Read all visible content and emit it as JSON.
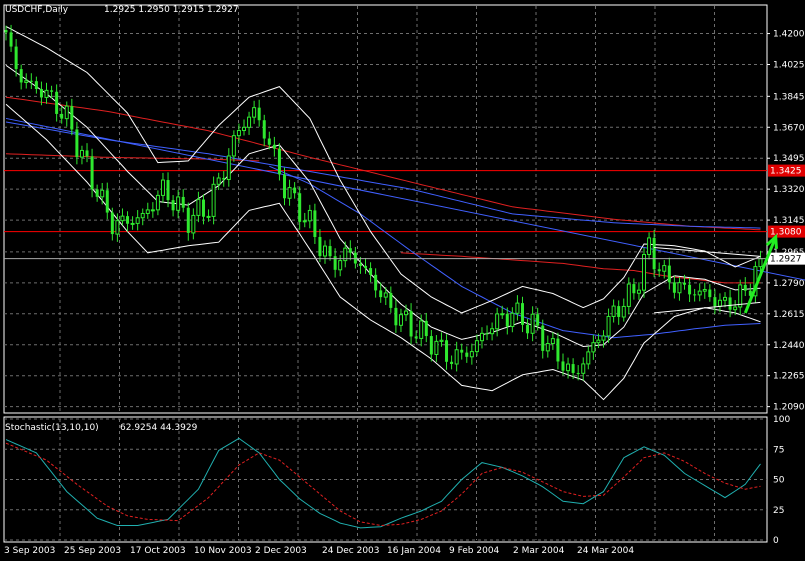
{
  "header": {
    "symbol_label": "USDCHF,Daily",
    "ohlc_text": "1.2925 1.2950 1.2915 1.2927"
  },
  "stochastic_header": {
    "label": "Stochastic(13,10,10)",
    "values_text": "62.9254 44.3929"
  },
  "colors": {
    "background": "#000000",
    "grid": "#6e6e6e",
    "candle": "#2fe82f",
    "bollinger": "#ffffff",
    "ma_red": "#e02020",
    "ma_blue": "#4060ff",
    "support_line": "#ff0000",
    "trend_line": "#4060ff",
    "arrow": "#22ee22",
    "stoch_main": "#20b0b0",
    "stoch_signal": "#e02020",
    "axis_text": "#ffffff",
    "label_red_bg": "#e00000"
  },
  "chart_data": [
    {
      "type": "candlestick",
      "title": "",
      "xlabel": "",
      "ylabel": "",
      "ylim": [
        1.2054,
        1.4288
      ],
      "y_ticks": [
        "1.4200",
        "1.4025",
        "1.3845",
        "1.3670",
        "1.3495",
        "1.3320",
        "1.3145",
        "1.2965",
        "1.2790",
        "1.2615",
        "1.2440",
        "1.2265",
        "1.2090"
      ],
      "x_tick_labels": [
        "3 Sep 2003",
        "25 Sep 2003",
        "17 Oct 2003",
        "10 Nov 2003",
        "2 Dec 2003",
        "24 Dec 2003",
        "16 Jan 2004",
        "9 Feb 2004",
        "2 Mar 2004",
        "24 Mar 2004"
      ],
      "grid": true,
      "last_price_label": "1.2927",
      "horizontal_levels": [
        {
          "value": 1.3425,
          "label": "1.3425"
        },
        {
          "value": 1.308,
          "label": "1.3080"
        }
      ],
      "bar_count": 150,
      "close_anchors": [
        [
          0,
          1.418
        ],
        [
          3,
          1.394
        ],
        [
          8,
          1.386
        ],
        [
          12,
          1.372
        ],
        [
          16,
          1.344
        ],
        [
          21,
          1.312
        ],
        [
          27,
          1.316
        ],
        [
          31,
          1.332
        ],
        [
          36,
          1.315
        ],
        [
          40,
          1.322
        ],
        [
          43,
          1.343
        ],
        [
          46,
          1.366
        ],
        [
          49,
          1.376
        ],
        [
          52,
          1.358
        ],
        [
          55,
          1.333
        ],
        [
          60,
          1.312
        ],
        [
          64,
          1.29
        ],
        [
          68,
          1.296
        ],
        [
          72,
          1.282
        ],
        [
          76,
          1.264
        ],
        [
          80,
          1.254
        ],
        [
          84,
          1.246
        ],
        [
          88,
          1.236
        ],
        [
          92,
          1.241
        ],
        [
          96,
          1.256
        ],
        [
          100,
          1.262
        ],
        [
          104,
          1.255
        ],
        [
          108,
          1.241
        ],
        [
          112,
          1.226
        ],
        [
          116,
          1.243
        ],
        [
          120,
          1.262
        ],
        [
          124,
          1.274
        ],
        [
          127,
          1.299
        ],
        [
          130,
          1.282
        ],
        [
          134,
          1.275
        ],
        [
          138,
          1.273
        ],
        [
          142,
          1.266
        ],
        [
          146,
          1.273
        ],
        [
          149,
          1.2927
        ]
      ],
      "bollinger_upper_anchors": [
        [
          0,
          1.424
        ],
        [
          8,
          1.412
        ],
        [
          16,
          1.398
        ],
        [
          24,
          1.375
        ],
        [
          30,
          1.347
        ],
        [
          36,
          1.348
        ],
        [
          42,
          1.368
        ],
        [
          48,
          1.384
        ],
        [
          54,
          1.39
        ],
        [
          60,
          1.372
        ],
        [
          66,
          1.337
        ],
        [
          72,
          1.308
        ],
        [
          78,
          1.284
        ],
        [
          84,
          1.271
        ],
        [
          90,
          1.262
        ],
        [
          96,
          1.269
        ],
        [
          102,
          1.277
        ],
        [
          108,
          1.273
        ],
        [
          114,
          1.265
        ],
        [
          118,
          1.27
        ],
        [
          122,
          1.282
        ],
        [
          126,
          1.301
        ],
        [
          132,
          1.3
        ],
        [
          138,
          1.297
        ],
        [
          144,
          1.288
        ],
        [
          149,
          1.294
        ]
      ],
      "bollinger_middle_anchors": [
        [
          0,
          1.402
        ],
        [
          8,
          1.386
        ],
        [
          16,
          1.367
        ],
        [
          24,
          1.342
        ],
        [
          30,
          1.325
        ],
        [
          36,
          1.323
        ],
        [
          42,
          1.334
        ],
        [
          48,
          1.352
        ],
        [
          54,
          1.357
        ],
        [
          60,
          1.336
        ],
        [
          66,
          1.304
        ],
        [
          72,
          1.284
        ],
        [
          78,
          1.267
        ],
        [
          84,
          1.254
        ],
        [
          90,
          1.247
        ],
        [
          96,
          1.251
        ],
        [
          102,
          1.257
        ],
        [
          108,
          1.251
        ],
        [
          114,
          1.243
        ],
        [
          118,
          1.244
        ],
        [
          122,
          1.254
        ],
        [
          126,
          1.273
        ],
        [
          132,
          1.283
        ],
        [
          138,
          1.281
        ],
        [
          144,
          1.275
        ],
        [
          149,
          1.276
        ]
      ],
      "bollinger_lower_anchors": [
        [
          0,
          1.38
        ],
        [
          8,
          1.36
        ],
        [
          16,
          1.336
        ],
        [
          24,
          1.308
        ],
        [
          28,
          1.296
        ],
        [
          36,
          1.3
        ],
        [
          42,
          1.302
        ],
        [
          48,
          1.32
        ],
        [
          54,
          1.324
        ],
        [
          60,
          1.298
        ],
        [
          66,
          1.271
        ],
        [
          72,
          1.258
        ],
        [
          78,
          1.248
        ],
        [
          84,
          1.236
        ],
        [
          90,
          1.221
        ],
        [
          96,
          1.218
        ],
        [
          102,
          1.227
        ],
        [
          108,
          1.23
        ],
        [
          114,
          1.224
        ],
        [
          118,
          1.213
        ],
        [
          122,
          1.225
        ],
        [
          126,
          1.245
        ],
        [
          132,
          1.26
        ],
        [
          138,
          1.265
        ],
        [
          144,
          1.262
        ],
        [
          149,
          1.257
        ]
      ],
      "ma_red_anchors": [
        [
          0,
          1.384
        ],
        [
          20,
          1.376
        ],
        [
          40,
          1.365
        ],
        [
          60,
          1.35
        ],
        [
          80,
          1.336
        ],
        [
          100,
          1.322
        ],
        [
          120,
          1.315
        ],
        [
          135,
          1.311
        ],
        [
          149,
          1.309
        ]
      ],
      "ma_blue_anchors": [
        [
          0,
          1.37
        ],
        [
          20,
          1.36
        ],
        [
          40,
          1.352
        ],
        [
          60,
          1.342
        ],
        [
          80,
          1.332
        ],
        [
          100,
          1.318
        ],
        [
          120,
          1.313
        ],
        [
          135,
          1.311
        ],
        [
          149,
          1.31
        ]
      ],
      "ma_red_fast_anchors": [
        [
          78,
          1.296
        ],
        [
          90,
          1.294
        ],
        [
          100,
          1.292
        ],
        [
          110,
          1.29
        ],
        [
          118,
          1.287
        ],
        [
          124,
          1.286
        ],
        [
          130,
          1.283
        ],
        [
          136,
          1.281
        ],
        [
          142,
          1.279
        ],
        [
          149,
          1.279
        ]
      ],
      "ma_blue_fast_anchors": [
        [
          52,
          1.345
        ],
        [
          60,
          1.335
        ],
        [
          70,
          1.318
        ],
        [
          80,
          1.297
        ],
        [
          90,
          1.277
        ],
        [
          100,
          1.262
        ],
        [
          110,
          1.252
        ],
        [
          120,
          1.248
        ],
        [
          128,
          1.25
        ],
        [
          136,
          1.253
        ],
        [
          142,
          1.255
        ],
        [
          149,
          1.256
        ]
      ],
      "ma_red_upper_anchors": [
        [
          0,
          1.352
        ],
        [
          20,
          1.35
        ],
        [
          40,
          1.349
        ],
        [
          50,
          1.348
        ]
      ],
      "trend_line": {
        "x1": 0,
        "y1": 1.372,
        "x2": 190,
        "y2": 1.262
      },
      "triangle": {
        "top_start": [
          128,
          1.299
        ],
        "top_end": [
          149,
          1.294
        ],
        "bottom_start": [
          128,
          1.262
        ],
        "bottom_end": [
          149,
          1.268
        ]
      },
      "arrow": {
        "from": [
          146,
          1.262
        ],
        "to": [
          152,
          1.305
        ]
      }
    },
    {
      "type": "line",
      "title": "",
      "ylim": [
        0,
        100
      ],
      "y_ticks": [
        "100",
        "75",
        "50",
        "25",
        "0"
      ],
      "grid": true,
      "series": [
        {
          "name": "",
          "color_key": "stoch_main",
          "anchors": [
            [
              0,
              83
            ],
            [
              6,
              72
            ],
            [
              12,
              40
            ],
            [
              18,
              18
            ],
            [
              22,
              12
            ],
            [
              26,
              12
            ],
            [
              32,
              17
            ],
            [
              38,
              42
            ],
            [
              42,
              74
            ],
            [
              46,
              84
            ],
            [
              50,
              72
            ],
            [
              54,
              50
            ],
            [
              58,
              34
            ],
            [
              62,
              22
            ],
            [
              66,
              14
            ],
            [
              70,
              10
            ],
            [
              74,
              11
            ],
            [
              78,
              18
            ],
            [
              82,
              24
            ],
            [
              86,
              32
            ],
            [
              90,
              50
            ],
            [
              94,
              64
            ],
            [
              98,
              60
            ],
            [
              102,
              53
            ],
            [
              106,
              44
            ],
            [
              110,
              32
            ],
            [
              114,
              30
            ],
            [
              118,
              40
            ],
            [
              122,
              68
            ],
            [
              126,
              77
            ],
            [
              130,
              70
            ],
            [
              134,
              55
            ],
            [
              138,
              45
            ],
            [
              142,
              35
            ],
            [
              146,
              46
            ],
            [
              149,
              62.9
            ]
          ]
        },
        {
          "name": "",
          "color_key": "stoch_signal",
          "anchors": [
            [
              0,
              80
            ],
            [
              8,
              66
            ],
            [
              14,
              46
            ],
            [
              20,
              28
            ],
            [
              24,
              20
            ],
            [
              28,
              17
            ],
            [
              34,
              16
            ],
            [
              40,
              35
            ],
            [
              46,
              62
            ],
            [
              50,
              72
            ],
            [
              54,
              66
            ],
            [
              58,
              52
            ],
            [
              62,
              38
            ],
            [
              66,
              24
            ],
            [
              70,
              15
            ],
            [
              74,
              12
            ],
            [
              78,
              13
            ],
            [
              82,
              17
            ],
            [
              86,
              24
            ],
            [
              90,
              38
            ],
            [
              94,
              55
            ],
            [
              98,
              60
            ],
            [
              102,
              56
            ],
            [
              106,
              48
            ],
            [
              110,
              40
            ],
            [
              114,
              36
            ],
            [
              118,
              37
            ],
            [
              122,
              52
            ],
            [
              126,
              68
            ],
            [
              130,
              72
            ],
            [
              134,
              65
            ],
            [
              138,
              55
            ],
            [
              142,
              47
            ],
            [
              146,
              42
            ],
            [
              149,
              44.4
            ]
          ]
        }
      ]
    }
  ]
}
